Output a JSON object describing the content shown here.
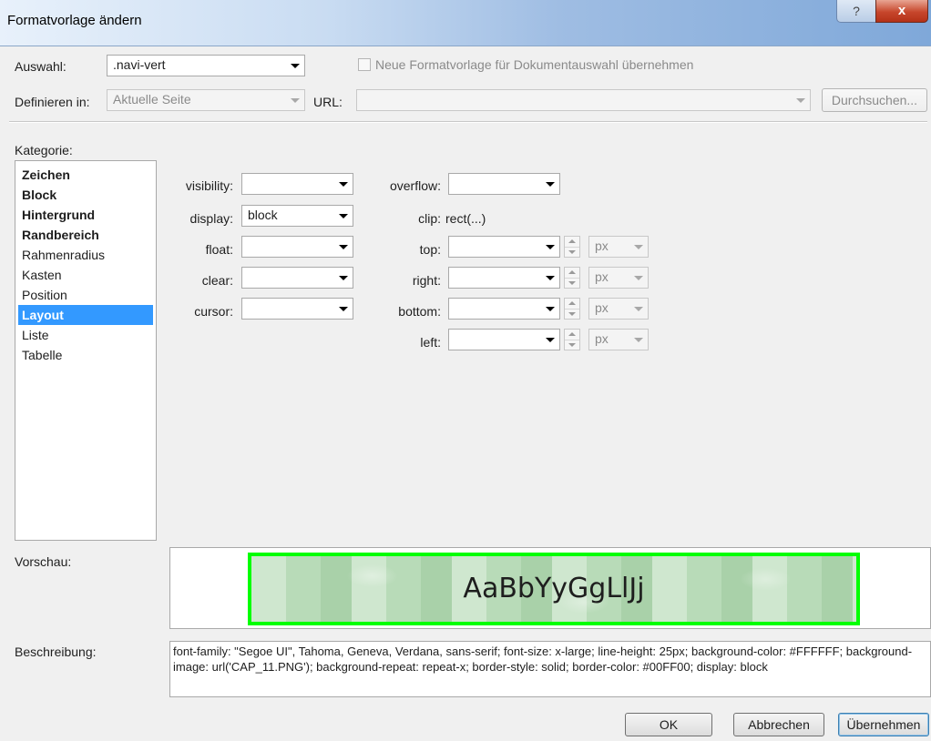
{
  "window": {
    "title": "Formatvorlage ändern",
    "help_label": "?",
    "close_label": "x"
  },
  "top": {
    "auswahl_label": "Auswahl:",
    "auswahl_value": ".navi-vert",
    "checkbox_label": "Neue Formatvorlage für Dokumentauswahl übernehmen",
    "checkbox_checked": false,
    "definieren_label": "Definieren in:",
    "definieren_value": "Aktuelle Seite",
    "url_label": "URL:",
    "url_value": "",
    "browse_label": "Durchsuchen..."
  },
  "category": {
    "label": "Kategorie:",
    "items": [
      {
        "label": "Zeichen",
        "bold": true
      },
      {
        "label": "Block",
        "bold": true
      },
      {
        "label": "Hintergrund",
        "bold": true
      },
      {
        "label": "Randbereich",
        "bold": true
      },
      {
        "label": "Rahmenradius",
        "bold": false
      },
      {
        "label": "Kasten",
        "bold": false
      },
      {
        "label": "Position",
        "bold": false
      },
      {
        "label": "Layout",
        "bold": true,
        "selected": true
      },
      {
        "label": "Liste",
        "bold": false
      },
      {
        "label": "Tabelle",
        "bold": false
      }
    ]
  },
  "layout": {
    "visibility_label": "visibility:",
    "visibility_value": "",
    "display_label": "display:",
    "display_value": "block",
    "float_label": "float:",
    "float_value": "",
    "clear_label": "clear:",
    "clear_value": "",
    "cursor_label": "cursor:",
    "cursor_value": "",
    "overflow_label": "overflow:",
    "overflow_value": "",
    "clip_label": "clip:",
    "clip_value": "rect(...)",
    "top_label": "top:",
    "top_value": "",
    "top_unit": "px",
    "right_label": "right:",
    "right_value": "",
    "right_unit": "px",
    "bottom_label": "bottom:",
    "bottom_value": "",
    "bottom_unit": "px",
    "left_label": "left:",
    "left_value": "",
    "left_unit": "px"
  },
  "preview": {
    "label": "Vorschau:",
    "sample_text": "AaBbYyGgLlJj",
    "border_color": "#00ff00"
  },
  "description": {
    "label": "Beschreibung:",
    "text": "font-family: \"Segoe UI\", Tahoma, Geneva, Verdana, sans-serif; font-size: x-large; line-height: 25px; background-color: #FFFFFF; background-image: url('CAP_11.PNG'); background-repeat: repeat-x; border-style: solid; border-color: #00FF00; display: block"
  },
  "buttons": {
    "ok": "OK",
    "cancel": "Abbrechen",
    "apply": "Übernehmen"
  },
  "colors": {
    "selection": "#3399ff",
    "close": "#c7472c"
  }
}
